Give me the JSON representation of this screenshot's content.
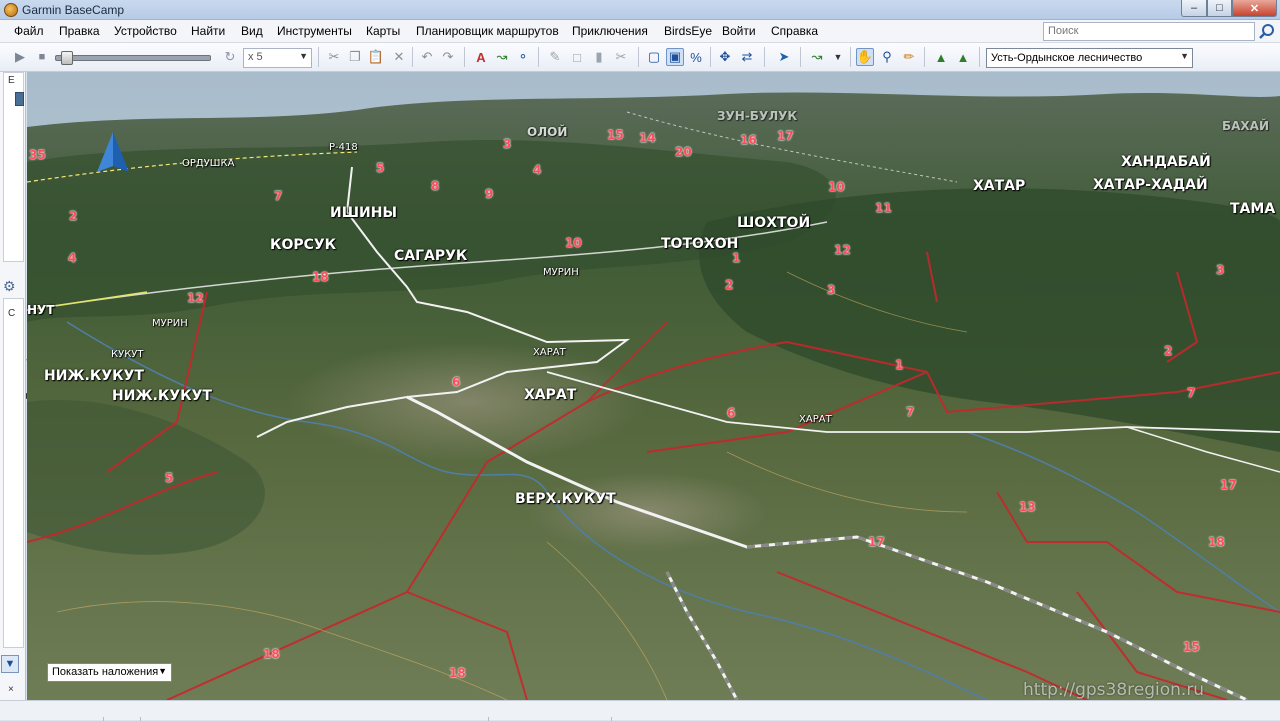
{
  "window": {
    "title": "Garmin BaseCamp"
  },
  "menu": {
    "items": [
      "Файл",
      "Правка",
      "Устройство",
      "Найти",
      "Вид",
      "Инструменты",
      "Карты",
      "Планировщик маршрутов",
      "Приключения",
      "BirdsEye",
      "Войти",
      "Справка"
    ],
    "search_placeholder": "Поиск"
  },
  "toolbar": {
    "speed_value": "x 5",
    "speed_options": [
      "x 5"
    ],
    "region_value": "Усть-Ордынское лесничество",
    "playback_progress": 0.04
  },
  "left_panel": {
    "top_letter": "E",
    "mid_letter": "C"
  },
  "map": {
    "overlay_button": "Показать наложения",
    "watermark": "http://gps38region.ru",
    "places": {
      "p1": "ОРДУШКА",
      "p2": "Р-418",
      "p3": "ОЛОЙ",
      "p4": "ЗУН-БУЛУК",
      "p5": "БАХАЙ",
      "p6": "ИШИНЫ",
      "p7": "КОРСУК",
      "p8": "САГАРУК",
      "p9": "ТОТОХОН",
      "p10": "ШОХТОЙ",
      "p11": "ХАТАР",
      "p12": "ХАНДАБАЙ",
      "p13": "ХАТАР-ХАДАЙ",
      "p14": "ТАМА",
      "p15": "МУРИН",
      "p16": "МУРИН",
      "p17": "НУТ",
      "p18": "КУКУТ",
      "p19": "НИЖ.КУКУТ",
      "p20": "НИЖ.КУКУТ",
      "p21": "ХАРАТ",
      "p22": "ХАРАТ",
      "p23": "ХАРАТ",
      "p24": "ВЕРХ.КУКУТ"
    },
    "numbers": {
      "n1": "35",
      "n2": "2",
      "n3": "4",
      "n4": "7",
      "n5": "5",
      "n6": "8",
      "n7": "3",
      "n8": "4",
      "n9": "9",
      "n10": "15",
      "n11": "14",
      "n12": "20",
      "n13": "16",
      "n14": "17",
      "n15": "10",
      "n16": "11",
      "n17": "12",
      "n18": "10",
      "n19": "1",
      "n20": "2",
      "n21": "3",
      "n22": "18",
      "n23": "12",
      "n24": "3",
      "n25": "2",
      "n26": "1",
      "n27": "7",
      "n28": "7",
      "n29": "6",
      "n30": "6",
      "n31": "5",
      "n32": "17",
      "n33": "13",
      "n34": "18",
      "n35": "17",
      "n36": "15",
      "n37": "18",
      "n38": "18"
    }
  },
  "colors": {
    "forest": "#3f5b36",
    "field": "#6f7d56",
    "sky": "#b9c9d6",
    "boundary": "#c8262c",
    "road": "#f2f2f2",
    "river": "#4f7fa8"
  }
}
